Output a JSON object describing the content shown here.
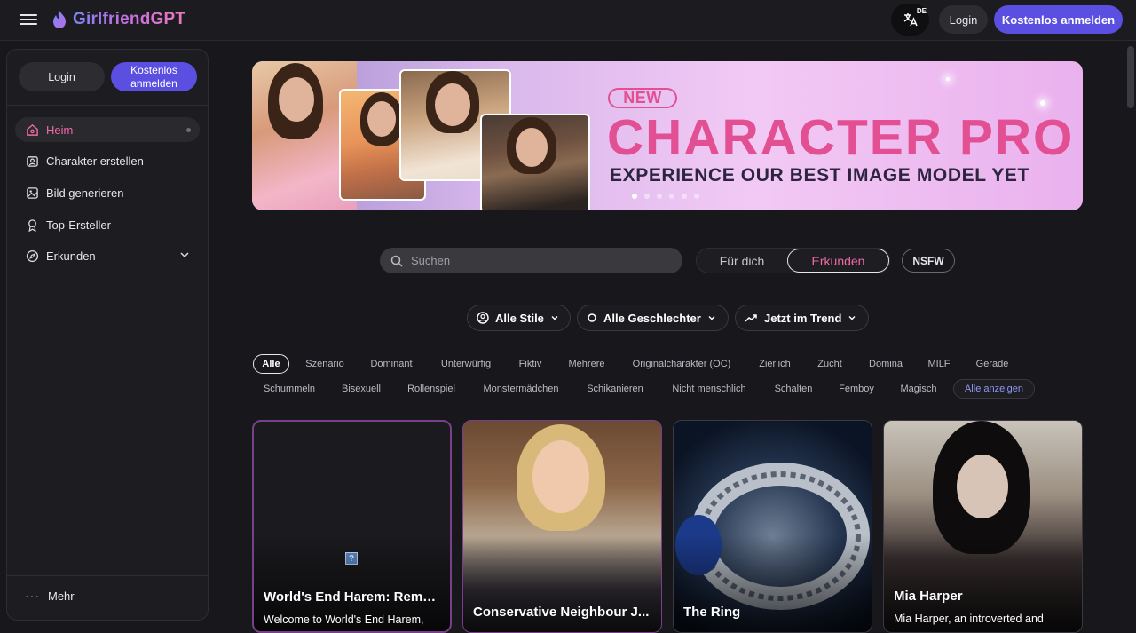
{
  "app": {
    "brand": "GirlfriendGPT"
  },
  "topbar": {
    "lang": "DE",
    "login": "Login",
    "signup": "Kostenlos anmelden"
  },
  "sidebar": {
    "login": "Login",
    "signup": "Kostenlos anmelden",
    "items": [
      {
        "label": "Heim",
        "icon": "home-icon",
        "active": true
      },
      {
        "label": "Charakter erstellen",
        "icon": "create-character-icon"
      },
      {
        "label": "Bild generieren",
        "icon": "image-icon"
      },
      {
        "label": "Top-Ersteller",
        "icon": "award-icon"
      },
      {
        "label": "Erkunden",
        "icon": "compass-icon"
      }
    ],
    "more": "Mehr"
  },
  "banner": {
    "badge": "NEW",
    "title": "CHARACTER PRO",
    "subtitle": "EXPERIENCE OUR BEST IMAGE MODEL YET",
    "slide_count": 6,
    "active_slide": 1
  },
  "search": {
    "placeholder": "Suchen"
  },
  "feed_toggle": {
    "option_a": "Für dich",
    "option_b": "Erkunden",
    "selected": "Erkunden"
  },
  "nsfw": "NSFW",
  "filters": {
    "style": "Alle Stile",
    "gender": "Alle Geschlechter",
    "sort": "Jetzt im Trend"
  },
  "tags_row1": [
    "Alle",
    "Szenario",
    "Dominant",
    "Unterwürfig",
    "Fiktiv",
    "Mehrere",
    "Originalcharakter (OC)",
    "Zierlich",
    "Zucht",
    "Domina",
    "MILF",
    "Gerade"
  ],
  "tags_row2": [
    "Schummeln",
    "Bisexuell",
    "Rollenspiel",
    "Monstermädchen",
    "Schikanieren",
    "Nicht menschlich",
    "Schalten",
    "Femboy",
    "Magisch",
    "Alle anzeigen"
  ],
  "cards": [
    {
      "title": "World's End Harem: Remake",
      "desc": "Welcome to World's End Harem,"
    },
    {
      "title": "Conservative Neighbour J...",
      "desc": ""
    },
    {
      "title": "The Ring",
      "desc": ""
    },
    {
      "title": "Mia Harper",
      "desc": "Mia Harper, an introverted and"
    }
  ],
  "colors": {
    "accent": "#5a4fe0",
    "pink": "#ee6aa7",
    "banner_title": "#e34f93"
  }
}
